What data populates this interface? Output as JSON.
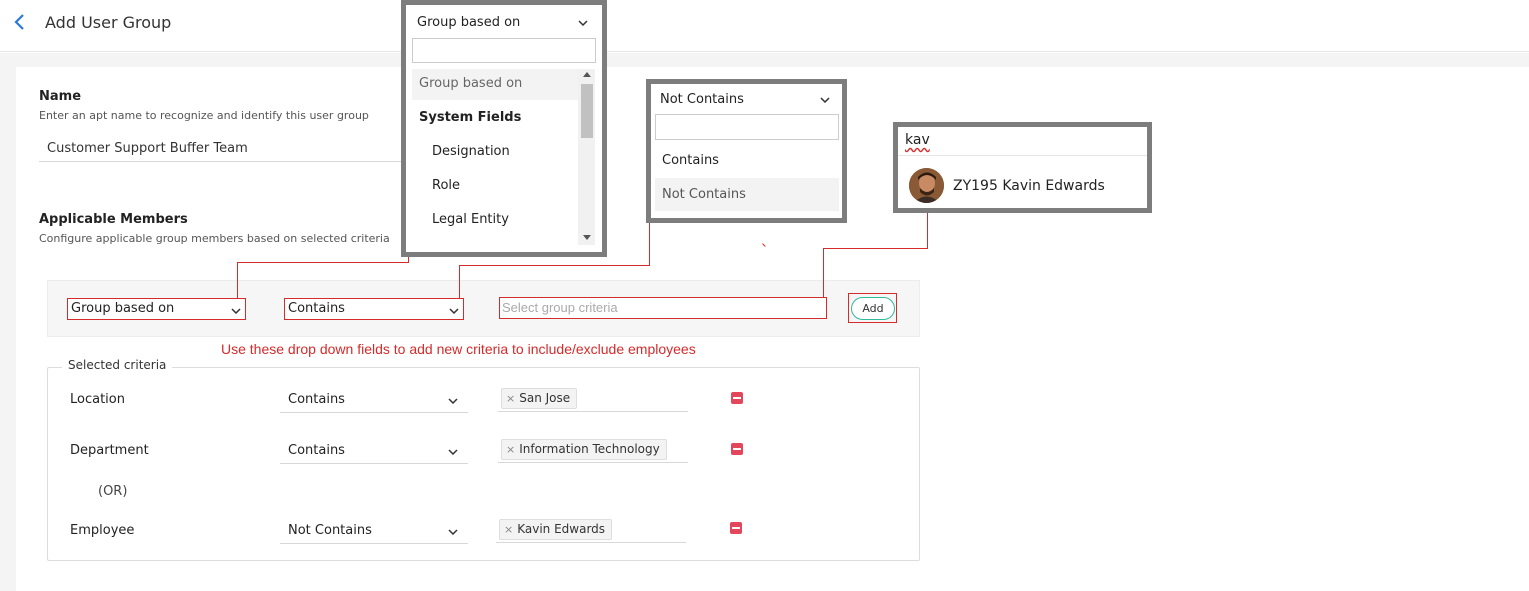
{
  "header": {
    "title": "Add User Group",
    "back_icon": "chevron-left-icon",
    "accent": "#2b7bd6"
  },
  "name_section": {
    "label": "Name",
    "help": "Enter an apt name to recognize and identify this user group",
    "value": "Customer Support Buffer Team"
  },
  "members_section": {
    "label": "Applicable Members",
    "help": "Configure applicable group members based on selected criteria"
  },
  "criteria_bar": {
    "group_select": "Group based on",
    "condition_select": "Contains",
    "criteria_placeholder": "Select group criteria",
    "add_label": "Add"
  },
  "hint": "Use these drop down fields to add new criteria to include/exclude employees",
  "selected": {
    "legend": "Selected criteria",
    "or_label": "(OR)",
    "rows": [
      {
        "label": "Location",
        "condition": "Contains",
        "chip": "San Jose"
      },
      {
        "label": "Department",
        "condition": "Contains",
        "chip": "Information Technology"
      },
      {
        "label": "Employee",
        "condition": "Not Contains",
        "chip": "Kavin Edwards"
      }
    ],
    "remove_color": "#e2475b"
  },
  "callout_group": {
    "header": "Group based on",
    "items": [
      "Group based on",
      "System Fields",
      "Designation",
      "Role",
      "Legal Entity"
    ]
  },
  "callout_condition": {
    "header": "Not Contains",
    "items": [
      "Contains",
      "Not Contains"
    ]
  },
  "callout_employee": {
    "query": "kav",
    "result": "ZY195 Kavin Edwards"
  },
  "colors": {
    "callout_border": "#7d7d7d",
    "highlight_red": "#d42b2b",
    "add_border": "#31b99a"
  }
}
